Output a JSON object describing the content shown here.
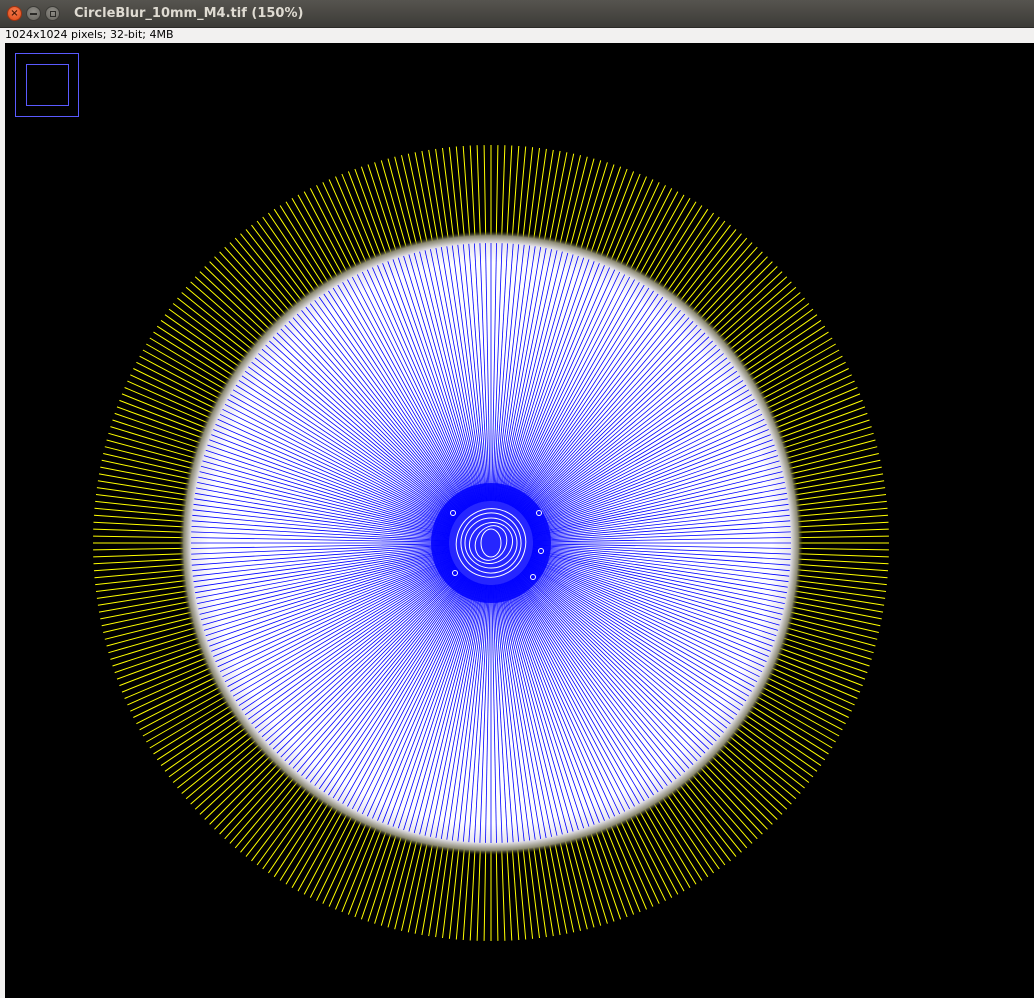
{
  "window": {
    "title": "CircleBlur_10mm_M4.tif (150%)",
    "info": "1024x1024 pixels; 32-bit; 4MB"
  },
  "colors": {
    "titlebar": "#3c3b37",
    "close_button": "#df4a16",
    "background": "#000000",
    "outer_rays": "#ffff00",
    "inner_rays": "#0000ff",
    "disc": "#ffffff",
    "navigator": "#5a5aff"
  },
  "icons": {
    "close": "close-icon",
    "minimize": "minimize-icon",
    "maximize": "maximize-icon"
  }
}
